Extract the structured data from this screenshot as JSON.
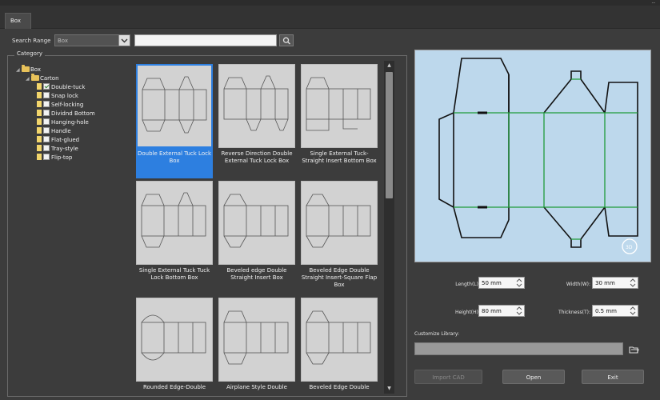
{
  "window": {
    "control_hint": "--"
  },
  "tabs": [
    {
      "label": "Box"
    }
  ],
  "search": {
    "range_label": "Search Range",
    "range_value": "Box",
    "query": "",
    "placeholder": ""
  },
  "category_label": "Category",
  "tree": {
    "root": "Box",
    "group": "Carton",
    "items": [
      {
        "label": "Double-tuck",
        "checked": true
      },
      {
        "label": "Snap lock",
        "checked": false
      },
      {
        "label": "Self-locking",
        "checked": false
      },
      {
        "label": "Dividnd Bottom",
        "checked": false
      },
      {
        "label": "Hanging-hole",
        "checked": false
      },
      {
        "label": "Handle",
        "checked": false
      },
      {
        "label": "Flat-glued",
        "checked": false
      },
      {
        "label": "Tray-style",
        "checked": false
      },
      {
        "label": "Flip-top",
        "checked": false
      }
    ]
  },
  "templates": [
    {
      "caption": "Double External Tuck Lock Box",
      "selected": true
    },
    {
      "caption": "Reverse Direction Double External Tuck Lock Box",
      "selected": false
    },
    {
      "caption": "Single External Tuck-Straight Insert Bottom Box",
      "selected": false
    },
    {
      "caption": "Single External Tuck Tuck Lock Bottom Box",
      "selected": false
    },
    {
      "caption": "Beveled edge Double Straight Insert Box",
      "selected": false
    },
    {
      "caption": "Beveled Edge Double Straight Insert-Square Flap Box",
      "selected": false
    },
    {
      "caption": "Rounded Edge-Double",
      "selected": false
    },
    {
      "caption": "Airplane Style Double",
      "selected": false
    },
    {
      "caption": "Beveled Edge Double",
      "selected": false
    }
  ],
  "params": {
    "length_label": "Length(L):",
    "length_value": "50 mm",
    "width_label": "Width(W):",
    "width_value": "30 mm",
    "height_label": "Height(H):",
    "height_value": "80 mm",
    "thickness_label": "Thickness(T):",
    "thickness_value": "0.5 mm"
  },
  "library": {
    "label": "Customize Library:",
    "value": ""
  },
  "buttons": {
    "import": "Import CAD",
    "open": "Open",
    "exit": "Exit"
  },
  "colors": {
    "accent": "#2d7fe0",
    "preview_bg": "#bdd8ec",
    "fold_line": "#1f9a3a",
    "cut_line": "#111111"
  }
}
